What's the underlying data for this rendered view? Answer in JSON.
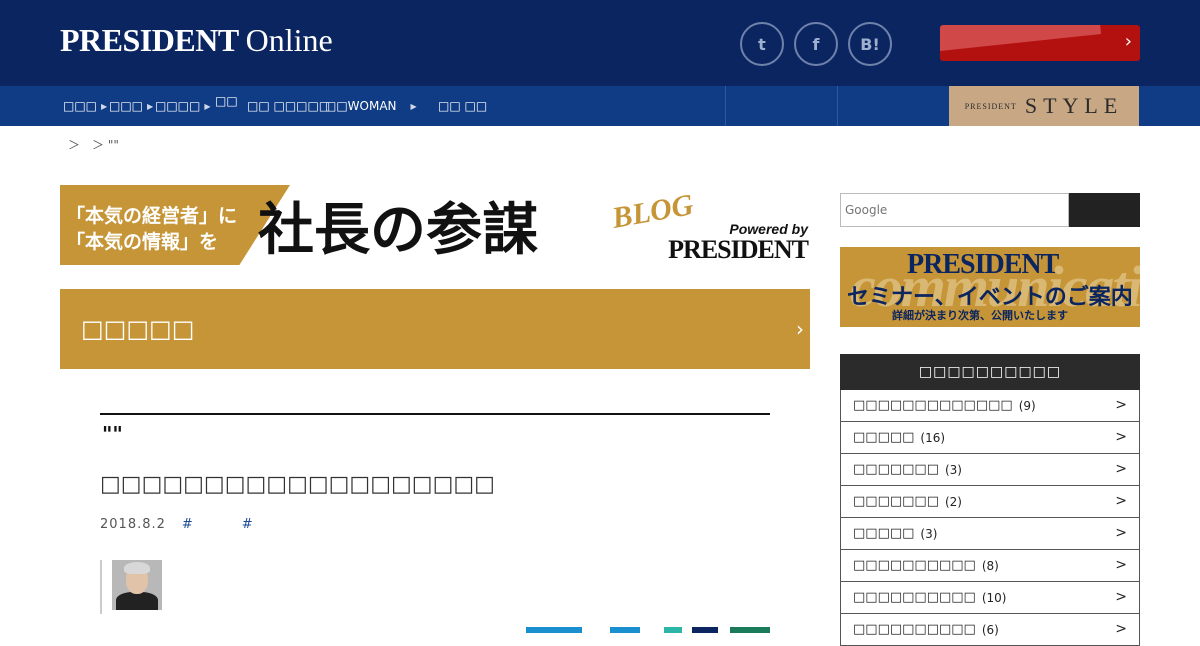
{
  "header": {
    "logo_main": "PRESIDENT",
    "logo_online": "Online",
    "social": [
      {
        "icon": "twitter-icon",
        "glyph": "t"
      },
      {
        "icon": "facebook-icon",
        "glyph": "f"
      },
      {
        "icon": "hatena-bookmark-icon",
        "glyph": "B!"
      }
    ],
    "red_button_chevron": "›"
  },
  "nav": {
    "items": [
      {
        "label": "□□□",
        "arrow": "▶"
      },
      {
        "label": "□□□",
        "arrow": "▶"
      },
      {
        "label": "□□□□",
        "arrow": "▶"
      },
      {
        "label": "□□"
      },
      {
        "label": "□□ □□□□□"
      },
      {
        "label": "□□WOMAN",
        "arrow": "▶"
      },
      {
        "label": "□□ □□"
      }
    ],
    "style_prefix": "PRESIDENT",
    "style_label": "STYLE"
  },
  "breadcrumb": "＞　＞ \"\"",
  "banner": {
    "tag1": "「本気の経営者」に",
    "tag2": "「本気の情報」を",
    "main": "社長の参謀",
    "blog": "BLOG",
    "powered": "Powered by",
    "brand": "PRESIDENT"
  },
  "section_bar": {
    "title": "□□□□□",
    "chevron": "›"
  },
  "article": {
    "quote": "\"\"",
    "headline": "□□□□□□□□□□□□□□□□□□□",
    "date": "2018.8.2",
    "tag1": "#",
    "tag2": "#"
  },
  "sidebar": {
    "search_placeholder": "Google",
    "seminar": {
      "bg_text": "communication",
      "brand": "PRESIDENT",
      "line1": "セミナー、イベントのご案内",
      "line2": "詳細が決まり次第、公開いたします"
    },
    "category_heading": "□□□□□□□□□□",
    "categories": [
      {
        "label": "□□□□□□□□□□□□□",
        "count": "(9)"
      },
      {
        "label": "□□□□□",
        "count": "(16)"
      },
      {
        "label": "□□□□□□□",
        "count": "(3)"
      },
      {
        "label": "□□□□□□□",
        "count": "(2)"
      },
      {
        "label": "□□□□□",
        "count": "(3)"
      },
      {
        "label": "□□□□□□□□□□",
        "count": "(8)"
      },
      {
        "label": "□□□□□□□□□□",
        "count": "(10)"
      },
      {
        "label": "□□□□□□□□□□",
        "count": "(6)"
      }
    ],
    "category_go": ">"
  },
  "colors": {
    "header_bg": "#0b2560",
    "nav_bg": "#0f3c84",
    "gold": "#c59537",
    "red": "#b31010"
  }
}
